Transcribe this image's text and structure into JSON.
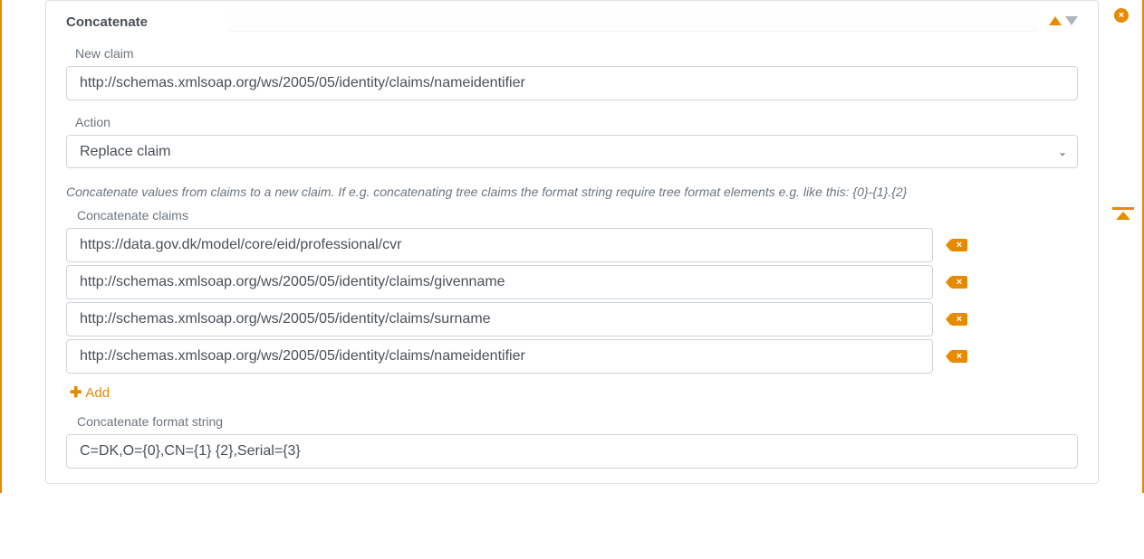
{
  "card": {
    "title": "Concatenate",
    "close_icon": "×"
  },
  "new_claim": {
    "label": "New claim",
    "value": "http://schemas.xmlsoap.org/ws/2005/05/identity/claims/nameidentifier"
  },
  "action": {
    "label": "Action",
    "selected": "Replace claim"
  },
  "help_text": "Concatenate values from claims to a new claim. If e.g. concatenating tree claims the format string require tree format elements e.g. like this: {0}-{1}.{2}",
  "claims": {
    "label": "Concatenate claims",
    "items": [
      {
        "value": "https://data.gov.dk/model/core/eid/professional/cvr"
      },
      {
        "value": "http://schemas.xmlsoap.org/ws/2005/05/identity/claims/givenname"
      },
      {
        "value": "http://schemas.xmlsoap.org/ws/2005/05/identity/claims/surname"
      },
      {
        "value": "http://schemas.xmlsoap.org/ws/2005/05/identity/claims/nameidentifier"
      }
    ],
    "delete_icon": "×",
    "add_label": "Add"
  },
  "format": {
    "label": "Concatenate format string",
    "value": "C=DK,O={0},CN={1} {2},Serial={3}"
  }
}
